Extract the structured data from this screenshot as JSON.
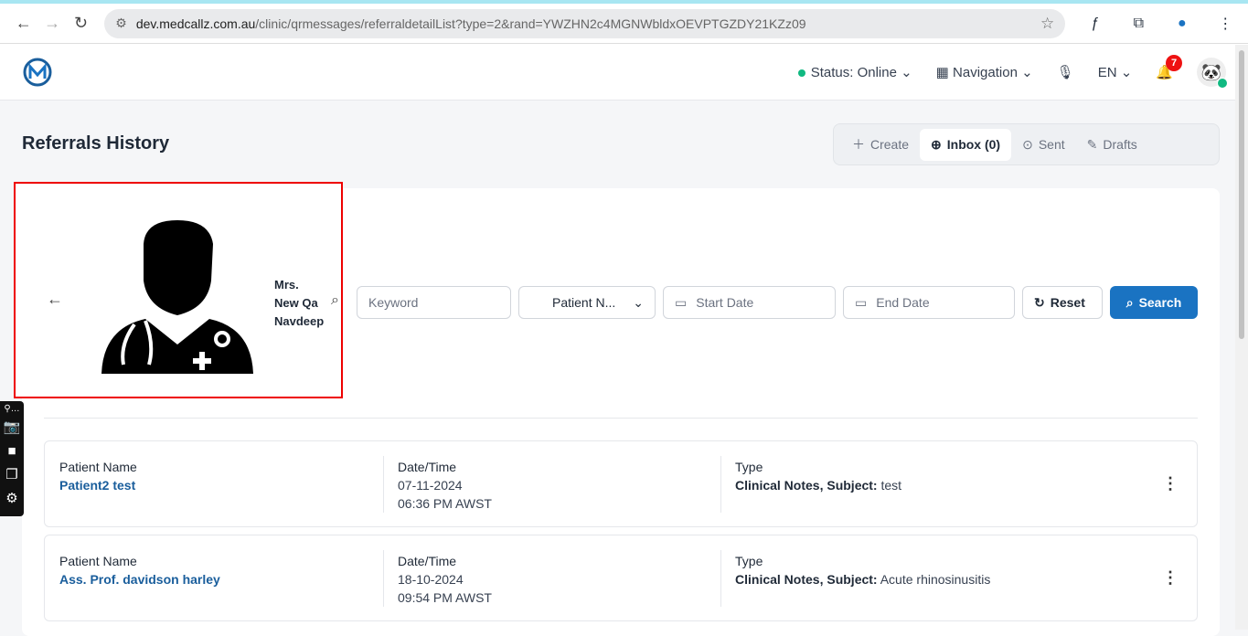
{
  "browser": {
    "url_host": "dev.medcallz.com.au",
    "url_path": "/clinic/qrmessages/referraldetailList?type=2&rand=YWZHN2c4MGNWbldxOEVPTGZDY21KZz09"
  },
  "header": {
    "status": "Status: Online",
    "navigation": "Navigation",
    "language": "EN",
    "notifications": "7"
  },
  "page": {
    "title": "Referrals History"
  },
  "tabs": [
    {
      "label": "Create",
      "icon": "plus-icon"
    },
    {
      "label": "Inbox (0)",
      "icon": "download-icon"
    },
    {
      "label": "Sent",
      "icon": "upload-icon"
    },
    {
      "label": "Drafts",
      "icon": "pen-icon"
    }
  ],
  "profile": {
    "name_line1": "Mrs.",
    "name_line2": "New Qa",
    "name_line3": "Navdeep"
  },
  "filters": {
    "keyword_placeholder": "Keyword",
    "patient_select": "Patient N...",
    "start_placeholder": "Start Date",
    "end_placeholder": "End Date",
    "reset": "Reset",
    "search": "Search"
  },
  "columns": {
    "patient": "Patient Name",
    "date": "Date/Time",
    "type": "Type",
    "subject_prefix": "Clinical Notes, Subject:"
  },
  "referrals": [
    {
      "patient": "Patient2 test",
      "date": "07-11-2024",
      "time": "06:36 PM AWST",
      "subject": "test"
    },
    {
      "patient": "Ass. Prof. davidson harley",
      "date": "18-10-2024",
      "time": "09:54 PM AWST",
      "subject": "Acute rhinosinusitis"
    }
  ],
  "colors": {
    "accent": "#1a73c2",
    "online": "#10b981",
    "highlight": "#e00000"
  }
}
